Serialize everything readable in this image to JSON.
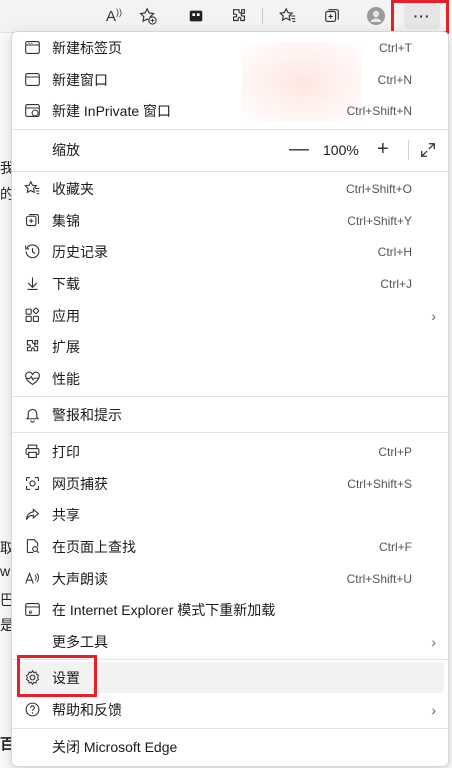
{
  "toolbar": {
    "read_aloud_label": "A",
    "more_label": "···"
  },
  "background": {
    "fragments": [
      "我",
      "的",
      "取",
      "wi",
      "巴",
      "是",
      "百"
    ]
  },
  "menu": {
    "items": [
      {
        "label": "新建标签页",
        "shortcut": "Ctrl+T"
      },
      {
        "label": "新建窗口",
        "shortcut": "Ctrl+N"
      },
      {
        "label": "新建 InPrivate 窗口",
        "shortcut": "Ctrl+Shift+N"
      },
      {
        "label": "缩放"
      },
      {
        "label": "收藏夹",
        "shortcut": "Ctrl+Shift+O"
      },
      {
        "label": "集锦",
        "shortcut": "Ctrl+Shift+Y"
      },
      {
        "label": "历史记录",
        "shortcut": "Ctrl+H"
      },
      {
        "label": "下载",
        "shortcut": "Ctrl+J"
      },
      {
        "label": "应用"
      },
      {
        "label": "扩展"
      },
      {
        "label": "性能"
      },
      {
        "label": "警报和提示"
      },
      {
        "label": "打印",
        "shortcut": "Ctrl+P"
      },
      {
        "label": "网页捕获",
        "shortcut": "Ctrl+Shift+S"
      },
      {
        "label": "共享"
      },
      {
        "label": "在页面上查找",
        "shortcut": "Ctrl+F"
      },
      {
        "label": "大声朗读",
        "shortcut": "Ctrl+Shift+U"
      },
      {
        "label": "在 Internet Explorer 模式下重新加载"
      },
      {
        "label": "更多工具"
      },
      {
        "label": "设置"
      },
      {
        "label": "帮助和反馈"
      },
      {
        "label": "关闭 Microsoft Edge"
      }
    ],
    "zoom": {
      "minus": "—",
      "value": "100%",
      "plus": "+"
    },
    "chevron": "›"
  },
  "colors": {
    "highlight_box": "#e5202a",
    "hover_bg": "#f2f2f2"
  }
}
